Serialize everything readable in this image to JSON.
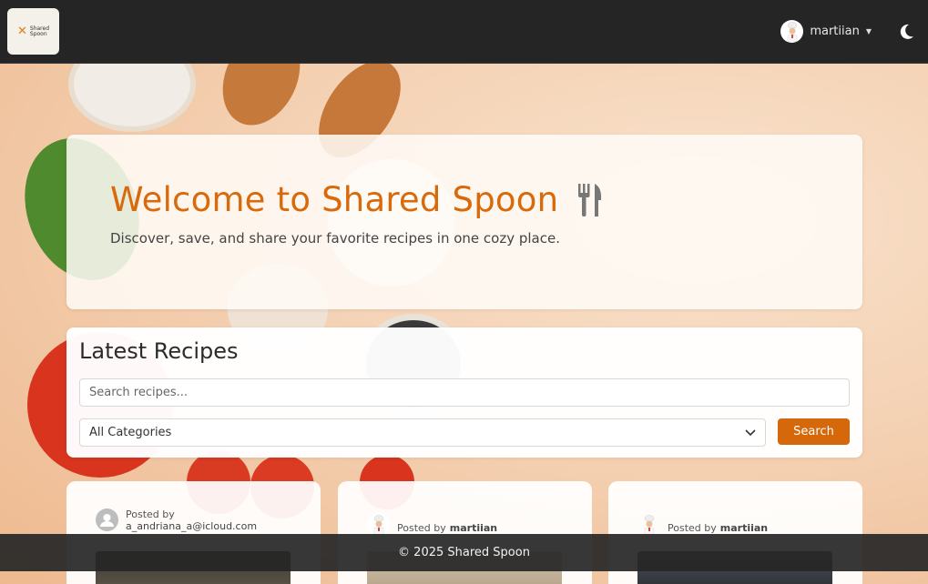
{
  "navbar": {
    "brand": {
      "logo_line1": "Shared",
      "logo_line2": "Spoon",
      "logo_icon": "crossed-utensils-icon"
    },
    "user": {
      "username": "martiian",
      "avatar_icon": "chef-avatar-icon",
      "caret_icon": "caret-down-icon"
    },
    "theme_toggle_icon": "moon-icon"
  },
  "hero": {
    "title": "Welcome to Shared Spoon",
    "title_icon": "fork-knife-icon",
    "subtitle": "Discover, save, and share your favorite recipes in one cozy place."
  },
  "latest": {
    "heading": "Latest Recipes",
    "search_placeholder": "Search recipes...",
    "search_value": "",
    "category_selected": "All Categories",
    "search_button": "Search"
  },
  "cards": [
    {
      "posted_by_label": "Posted by",
      "author": "a_andriana_a@icloud.com",
      "avatar_icon": "default-user-icon"
    },
    {
      "posted_by_label": "Posted by",
      "author": "martiian",
      "avatar_icon": "chef-avatar-icon"
    },
    {
      "posted_by_label": "Posted by",
      "author": "martiian",
      "avatar_icon": "chef-avatar-icon"
    }
  ],
  "footer": {
    "text": "© 2025 Shared Spoon"
  },
  "colors": {
    "accent": "#d86a0c",
    "navbar": "#252525",
    "button": "#d4680a"
  }
}
